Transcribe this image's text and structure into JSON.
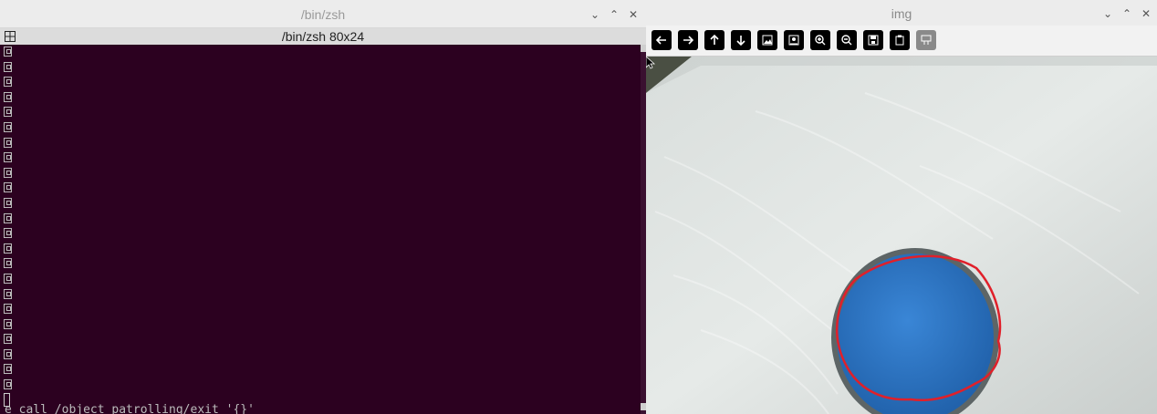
{
  "terminal": {
    "window_title": "/bin/zsh",
    "tab_title": "/bin/zsh 80x24",
    "last_line": "e call /object_patrolling/exit '{}'",
    "controls": [
      "chevron-down-icon",
      "chevron-up-icon",
      "close-icon"
    ],
    "placeholder_glyph_rows": 23,
    "background_color": "#2c0120"
  },
  "image_viewer": {
    "window_title": "img",
    "controls": [
      "chevron-down-icon",
      "chevron-up-icon",
      "close-icon"
    ],
    "toolbar_buttons": [
      {
        "icon": "arrow-left-icon",
        "enabled": true
      },
      {
        "icon": "arrow-right-icon",
        "enabled": true
      },
      {
        "icon": "arrow-up-icon",
        "enabled": true
      },
      {
        "icon": "arrow-down-icon",
        "enabled": true
      },
      {
        "icon": "image-icon",
        "enabled": true
      },
      {
        "icon": "image-settings-icon",
        "enabled": true
      },
      {
        "icon": "zoom-in-icon",
        "enabled": true
      },
      {
        "icon": "zoom-out-icon",
        "enabled": true
      },
      {
        "icon": "save-icon",
        "enabled": true
      },
      {
        "icon": "clipboard-icon",
        "enabled": true
      },
      {
        "icon": "properties-icon",
        "enabled": false
      }
    ],
    "scene": {
      "surface_color": "#dde2e0",
      "object_color": "#2f78c8",
      "contour_color": "#e0202a"
    }
  }
}
